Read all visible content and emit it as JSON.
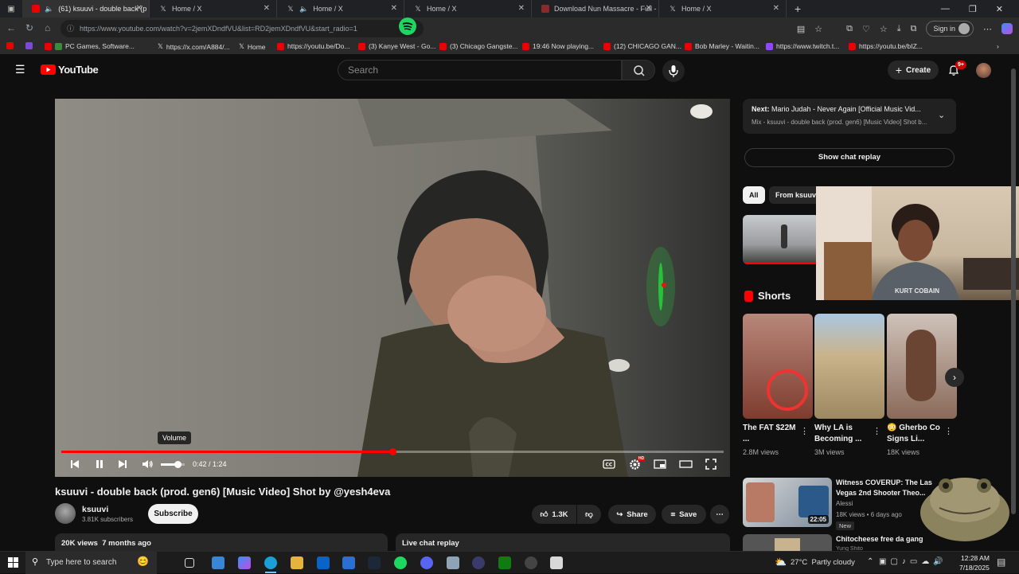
{
  "browser": {
    "tabs": [
      {
        "title": "(61) ksuuvi - double back (p",
        "icon": "youtube-audio"
      },
      {
        "title": "Home / X",
        "icon": "x-logo"
      },
      {
        "title": "Home / X",
        "icon": "x-audio"
      },
      {
        "title": "Home / X",
        "icon": "x-logo"
      },
      {
        "title": "Download Nun Massacre - Full -",
        "icon": "page"
      },
      {
        "title": "Home / X",
        "icon": "x-logo"
      }
    ],
    "url": "https://www.youtube.com/watch?v=2jemXDndfVU&list=RD2jemXDndfVU&start_radio=1",
    "signin_label": "Sign in",
    "bookmarks": [
      "PC Games, Software...",
      "https://x.com/A884/...",
      "Home",
      "https://youtu.be/Do...",
      "(3) Kanye West - Go...",
      "(3) Chicago Gangste...",
      "19:46 Now playing...",
      "(12) CHICAGO GAN...",
      "Bob Marley - Waitin...",
      "https://www.twitch.t...",
      "https://youtu.be/bIZ..."
    ]
  },
  "youtube": {
    "logo_text": "YouTube",
    "search_placeholder": "Search",
    "create_label": "Create",
    "notification_count": "9+"
  },
  "player": {
    "tooltip": "Volume",
    "time": "0:42 / 1:24",
    "progress_fraction": 0.5,
    "volume_fraction": 0.7
  },
  "video": {
    "title": "ksuuvi - double back (prod. gen6) [Music Video] Shot by @yesh4eva",
    "channel": "ksuuvi",
    "subscribers": "3.81K subscribers",
    "subscribe_label": "Subscribe",
    "likes": "1.3K",
    "share_label": "Share",
    "save_label": "Save",
    "views_line": "20K views  7 months ago",
    "live_chat_replay": "Live chat replay"
  },
  "sidebar": {
    "next_label": "Next:",
    "next_title": "Mario Judah - Never Again [Official Music Vid...",
    "next_sub": "Mix - ksuuvi - double back (prod. gen6) [Music Video] Shot b...",
    "show_chat_replay": "Show chat replay",
    "chips": [
      "All",
      "From ksuuvi"
    ],
    "shorts_heading": "Shorts",
    "shorts": [
      {
        "title": "The FAT $22M ...",
        "views": "2.8M views"
      },
      {
        "title": "Why LA is Becoming ...",
        "views": "3M views"
      },
      {
        "title": "😳 Gherbo Co Signs Li...",
        "views": "18K views"
      }
    ],
    "rec_video": {
      "title": "Witness COVERUP: The Las Vegas 2nd Shooter Theo...",
      "channel": "Alessi",
      "meta": "18K views • 6 days ago",
      "badge": "New",
      "duration": "22:05"
    },
    "rec_video2": {
      "title": "Chitocheese free da gang",
      "channel": "Yung Shito"
    }
  },
  "webcam": {
    "shirt_text": "KURT COBAIN"
  },
  "taskbar": {
    "search_placeholder": "Type here to search",
    "weather": "27°C  Partly cloudy",
    "time": "12:28 AM",
    "date": "7/18/2025"
  }
}
